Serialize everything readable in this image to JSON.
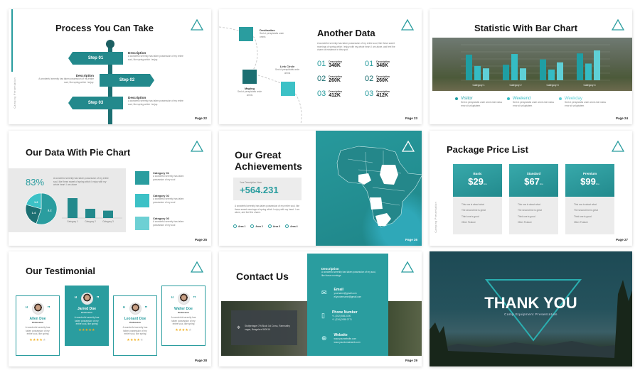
{
  "accent": "#2a9d9f",
  "slides": {
    "process": {
      "title": "Process You Can Take",
      "side": "Camping Presentation",
      "steps": [
        {
          "label": "Step 01",
          "desc_title": "Description",
          "desc": "A wonderful serenity has taken possession of my entire soul, like spring which I enjoy."
        },
        {
          "label": "Step 02",
          "desc_title": "Description",
          "desc": "A wonderful serenity has taken possession of my entire soul, like spring which I enjoy."
        },
        {
          "label": "Step 03",
          "desc_title": "Description",
          "desc": "A wonderful serenity has taken possession of my entire soul, like spring which I enjoy."
        }
      ],
      "page": "Page 22"
    },
    "another": {
      "title": "Another Data",
      "para": "A wonderful serenity has taken possession of my entire soul, like these sweet mornings of spring which I enjoy with my whole heart. I am alone, and feel the charm of existence in this spot.",
      "nodes": [
        {
          "label": "Destination",
          "desc": "Sed ut perspiciatis unde omnis"
        },
        {
          "label": "Link Circle",
          "desc": "Sed ut perspiciatis unde omnis"
        },
        {
          "label": "Maping",
          "desc": "Sed ut perspiciatis unde omnis"
        }
      ],
      "stats": [
        {
          "num": "01",
          "desc": "Description",
          "value": "348K"
        },
        {
          "num": "02",
          "desc": "Description",
          "value": "260K"
        },
        {
          "num": "03",
          "desc": "Description",
          "value": "412K"
        },
        {
          "num": "01",
          "desc": "Description",
          "value": "348K"
        },
        {
          "num": "02",
          "desc": "Description",
          "value": "260K"
        },
        {
          "num": "03",
          "desc": "Description",
          "value": "412K"
        }
      ],
      "page": "Page 23"
    },
    "barslide": {
      "title": "Statistic With Bar Chart",
      "legend": [
        {
          "name": "Visitor",
          "desc": "Sed ut perspiciatis unde omnis iste natus error sit voluptatem",
          "color": "#1f9ea3"
        },
        {
          "name": "Weekend",
          "desc": "Sed ut perspiciatis unde omnis iste natus error sit voluptatem",
          "color": "#35bcc4"
        },
        {
          "name": "Weekday",
          "desc": "Sed ut perspiciatis unde omnis iste natus error sit voluptatem",
          "color": "#5fd0d6"
        }
      ],
      "page": "Page 24"
    },
    "pie": {
      "title": "Our Data With Pie Chart",
      "percent": "83%",
      "para": "A wonderful serenity has taken possession of my entire soul, like these sweet of spring which I enjoy with my whole heart. I am alone",
      "cats": [
        {
          "label": "Category 01",
          "desc": "A wonderful serenity has taken possession of my soul"
        },
        {
          "label": "Category 02",
          "desc": "A wonderful serenity has taken possession of my soul"
        },
        {
          "label": "Category 03",
          "desc": "A wonderful serenity has taken possession of my soul"
        }
      ],
      "page": "Page 25"
    },
    "achieve": {
      "title1": "Our Great",
      "title2": "Achievements",
      "box_label": "Your Description Here",
      "value": "+564.231",
      "para": "A wonderful serenity has taken possession of my entire soul, like these sweet mornings of spring which I enjoy with my heart. I am alone, and feel the charm.",
      "areas": [
        "Area 1",
        "Area 2",
        "Area 3",
        "Area 4"
      ],
      "page": "Page 26"
    },
    "price": {
      "title": "Package Price List",
      "side": "Camping Presentation",
      "plans": [
        {
          "name": "Basic",
          "price": "$29",
          "unit": "/mo"
        },
        {
          "name": "Standard",
          "price": "$67",
          "unit": "/mo"
        },
        {
          "name": "Premium",
          "price": "$99",
          "unit": "/mo"
        }
      ],
      "features": [
        "This row is about what",
        "The second line is great",
        "Third one is good",
        "Other Feature"
      ],
      "page": "Page 27"
    },
    "testimonial": {
      "title": "Our Testimonial",
      "people": [
        {
          "name": "Allen Doe",
          "role": "Profession",
          "text": "A wonderful serenity has taken possession of my entire soul, like spring",
          "rating": 4
        },
        {
          "name": "Jarred Doe",
          "role": "Profession",
          "text": "A wonderful serenity has taken possession of my entire soul, like spring",
          "rating": 5
        },
        {
          "name": "Leonard Doe",
          "role": "Profession",
          "text": "A wonderful serenity has taken possession of my entire soul, like spring",
          "rating": 4
        },
        {
          "name": "Walter Doe",
          "role": "Profession",
          "text": "A wonderful serenity has taken possession of my entire soul, like spring",
          "rating": 4
        }
      ],
      "page": "Page 28"
    },
    "contact": {
      "title": "Contact Us",
      "address": "Stotlyertager 7th Block 1st Cross, Ramnurthy nagar, Bangalore 560016",
      "desc_title": "Description",
      "desc": "A wonderful serenity has taken possession of my soul, like these mornings",
      "items": [
        {
          "label": "Email",
          "lines": [
            "yourname@gmail.com",
            "ellyundername@gmail.com"
          ]
        },
        {
          "label": "Phone Number",
          "lines": [
            "+1 (202) 555-0190",
            "+1 (234) 2098 0771"
          ]
        },
        {
          "label": "Website",
          "lines": [
            "www.yourwebsite.com",
            "www.yourdomainweb.com"
          ]
        }
      ],
      "page": "Page 29"
    },
    "thanks": {
      "title": "THANK YOU",
      "subtitle": "Camp Equipment Presentation"
    }
  },
  "chart_data": [
    {
      "type": "bar",
      "categories": [
        "Category 1",
        "Category 2",
        "Category 3",
        "Category 4"
      ],
      "series": [
        {
          "name": "Visitor",
          "values": [
            4.3,
            2.6,
            3.5,
            4.5
          ]
        },
        {
          "name": "Weekend",
          "values": [
            2.4,
            4.4,
            1.8,
            2.8
          ]
        },
        {
          "name": "Weekday",
          "values": [
            2.0,
            2.0,
            3.0,
            5.0
          ]
        }
      ],
      "ylim": [
        0,
        5
      ],
      "grid": true
    },
    {
      "type": "pie",
      "values": [
        3.2,
        1.4,
        1.2
      ],
      "labels": [
        "3.2",
        "1.4",
        "1.2"
      ]
    },
    {
      "type": "bar",
      "categories": [
        "Category 1",
        "Category 2",
        "Category 3"
      ],
      "values": [
        4.3,
        2.0,
        1.6
      ]
    }
  ]
}
